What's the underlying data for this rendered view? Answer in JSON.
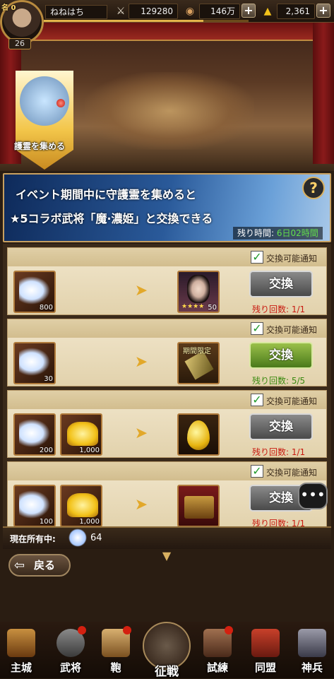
{
  "player": {
    "rank": "名 0",
    "name": "ねねはち",
    "level": "26",
    "exp_fraction": 0.78
  },
  "stats": {
    "power": "129280",
    "coins": "146万",
    "gold": "2,361"
  },
  "stage": {
    "banner_label": "護霊を集める"
  },
  "event": {
    "line1": "イベント期間中に守護霊を集めると",
    "line2": "★5コラボ武将「魔·濃姫」と交換できる",
    "time_label": "残り時間:",
    "time_value": "6日02時間",
    "help": "?"
  },
  "rows": [
    {
      "notify": "交換可能通知",
      "checked": true,
      "costs": [
        {
          "icon": "guardian-spirit",
          "count": "800"
        }
      ],
      "reward": {
        "icon": "general-portrait",
        "count": "50",
        "stars": "★★★★"
      },
      "button": "交換",
      "remaining_label": "残り回数: 1/1",
      "button_state": "gray"
    },
    {
      "notify": "交換可能通知",
      "checked": true,
      "costs": [
        {
          "icon": "guardian-spirit",
          "count": "30"
        }
      ],
      "reward": {
        "icon": "limited-scroll",
        "tag": "期間限定"
      },
      "button": "交換",
      "remaining_label": "残り回数: 5/5",
      "button_state": "green"
    },
    {
      "notify": "交換可能通知",
      "checked": true,
      "costs": [
        {
          "icon": "guardian-spirit",
          "count": "200"
        },
        {
          "icon": "gold-ingot",
          "count": "1,000"
        }
      ],
      "reward": {
        "icon": "golden-egg"
      },
      "button": "交換",
      "remaining_label": "残り回数: 1/1",
      "button_state": "gray"
    },
    {
      "notify": "交換可能通知",
      "checked": true,
      "costs": [
        {
          "icon": "guardian-spirit",
          "count": "100"
        },
        {
          "icon": "gold-ingot",
          "count": "1,000"
        }
      ],
      "reward": {
        "icon": "treasure-box"
      },
      "button": "交換",
      "remaining_label": "残り回数: 1/1",
      "button_state": "gray"
    }
  ],
  "owned": {
    "label": "現在所有中:",
    "value": "64"
  },
  "back": {
    "label": "戻る"
  },
  "nav": [
    {
      "label": "主城",
      "icon": "castle-icon"
    },
    {
      "label": "武将",
      "icon": "general-icon",
      "badge": true
    },
    {
      "label": "鞄",
      "icon": "bag-icon",
      "badge": true
    },
    {
      "label": "征戦",
      "icon": "swords-icon"
    },
    {
      "label": "試練",
      "icon": "trial-icon",
      "badge": true
    },
    {
      "label": "同盟",
      "icon": "alliance-icon"
    },
    {
      "label": "神兵",
      "icon": "divine-weapon-icon"
    }
  ],
  "colors": {
    "accent_gold": "#d8b060",
    "remaining_red": "#c81a10",
    "remaining_green": "#3a8a10",
    "time_green": "#62e04a"
  }
}
